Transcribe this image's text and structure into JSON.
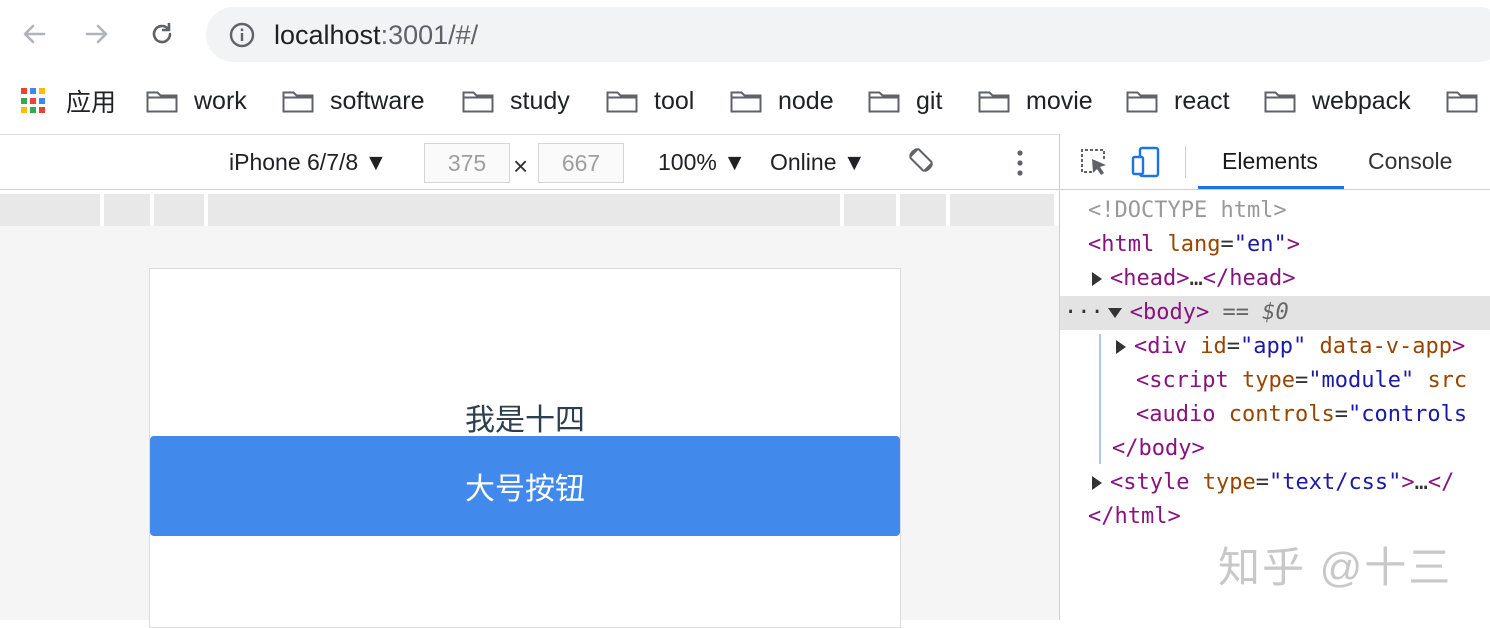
{
  "browser": {
    "url_host": "localhost",
    "url_rest": ":3001/#/"
  },
  "bookmarks": {
    "apps_label": "应用",
    "folders": [
      "work",
      "software",
      "study",
      "tool",
      "node",
      "git",
      "movie",
      "react",
      "webpack"
    ]
  },
  "device_toolbar": {
    "device": "iPhone 6/7/8 ▼",
    "width": "375",
    "height": "667",
    "times": "×",
    "zoom": "100% ▼",
    "network": "Online ▼"
  },
  "page": {
    "text": "我是十四",
    "button_label": "大号按钮",
    "button_color": "#4189eb"
  },
  "devtools": {
    "tabs": [
      "Elements",
      "Console"
    ],
    "active_tab": "Elements",
    "dom": {
      "doctype": "<!DOCTYPE html>",
      "html_open_tag": "html",
      "html_lang_attr": "lang",
      "html_lang_val": "\"en\"",
      "head": "head",
      "head_ellipsis": "…",
      "body": "body",
      "body_eq": "==",
      "body_var": "$0",
      "div_tag": "div",
      "div_id_attr": "id",
      "div_id_val": "\"app\"",
      "div_data_attr": "data-v-app",
      "script_tag": "script",
      "script_type_attr": "type",
      "script_type_val": "\"module\"",
      "script_src_attr": "src",
      "audio_tag": "audio",
      "audio_controls_attr": "controls",
      "audio_controls_val": "\"controls",
      "style_tag": "style",
      "style_type_attr": "type",
      "style_type_val": "\"text/css\"",
      "ellipsis_dots": "···"
    }
  },
  "watermark": "知乎 @十三"
}
